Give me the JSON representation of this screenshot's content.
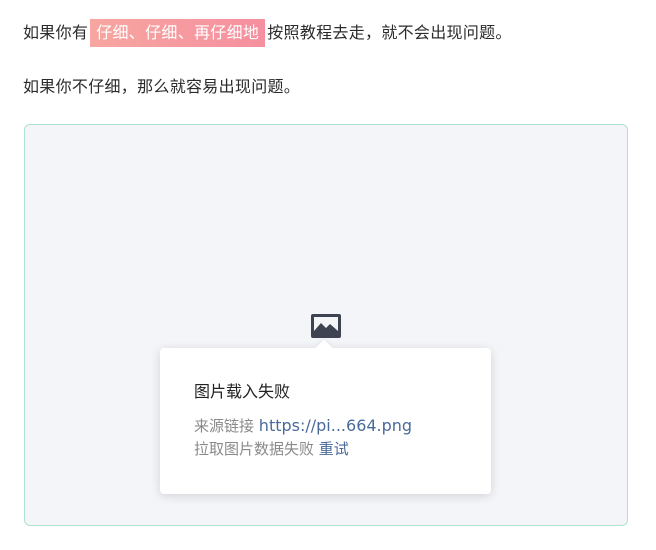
{
  "article": {
    "para1_prefix": "如果你有",
    "para1_highlight": "仔细、仔细、再仔细地",
    "para1_suffix": "按照教程去走，就不会出现问题。",
    "para2": "如果你不仔细，那么就容易出现问题。"
  },
  "image_error": {
    "icon": "image-icon",
    "title": "图片载入失败",
    "source_label": "来源链接",
    "source_link": "https://pi...664.png",
    "fetch_error": "拉取图片数据失败",
    "retry_label": "重试"
  },
  "colors": {
    "highlight_start": "#f7a6a0",
    "highlight_end": "#f68f9f",
    "frame_border": "#aee3d0",
    "frame_bg": "#f4f5f8",
    "link": "#4a6a9a"
  }
}
